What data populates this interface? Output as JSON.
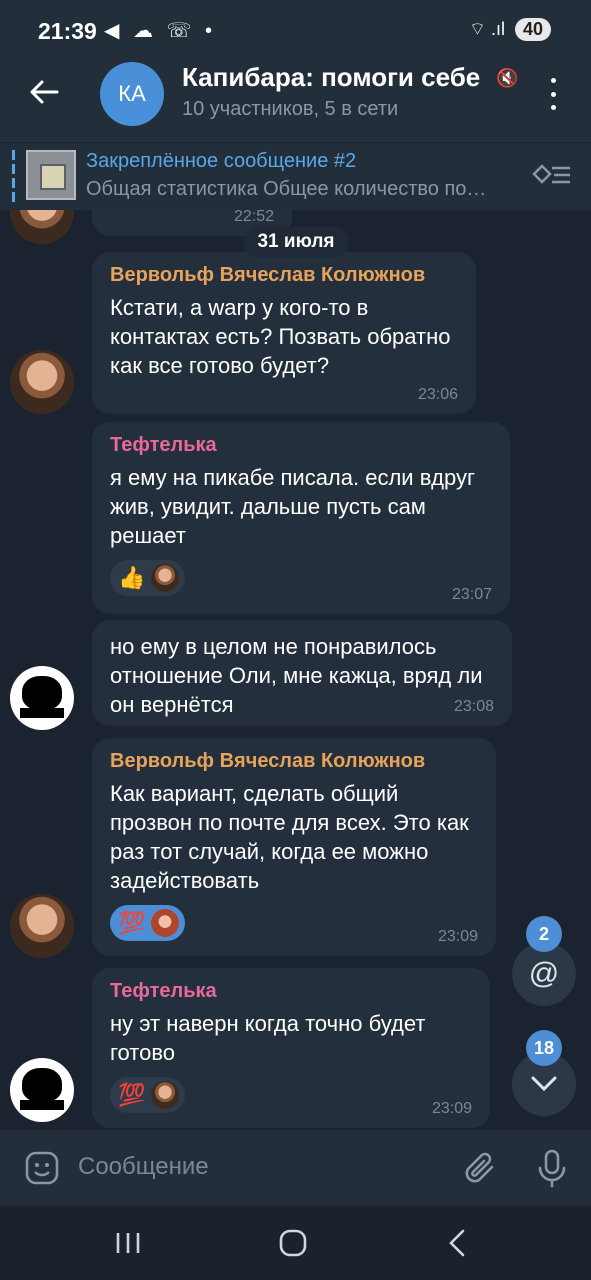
{
  "status": {
    "time": "21:39",
    "icons": "◀ ☁ ☏ •",
    "signal": "⌔ .ıl",
    "battery": "40"
  },
  "header": {
    "avatar_initials": "КА",
    "title": "Капибара: помоги себе",
    "subtitle": "10 участников, 5 в сети"
  },
  "pinned": {
    "title": "Закреплённое сообщение #2",
    "text": "Общая статистика Общее количество по…"
  },
  "partial_top": {
    "time": "22:52"
  },
  "date_chip": "31 июля",
  "messages": [
    {
      "sender": "Вервольф Вячеслав Колюжнов",
      "sender_color": "#e8a35a",
      "text": "Кстати, а warp у кого-то в контактах есть? Позвать обратно как все готово будет?",
      "time": "23:06"
    },
    {
      "sender": "Тефтелька",
      "sender_color": "#e86a9a",
      "text": "я ему на пикабе писала. если вдруг жив, увидит. дальше пусть сам решает",
      "time": "23:07",
      "reaction": "👍"
    },
    {
      "text": "но ему в целом не понравилось отношение Оли, мне кажца, вряд ли он вернётся",
      "time": "23:08"
    },
    {
      "sender": "Вервольф Вячеслав Колюжнов",
      "sender_color": "#e8a35a",
      "text": "Как вариант, сделать общий прозвон по почте для всех. Это как раз тот случай, когда ее можно задействовать",
      "time": "23:09",
      "reaction": "💯"
    },
    {
      "sender": "Тефтелька",
      "sender_color": "#e86a9a",
      "text": "ну эт наверн когда точно будет готово",
      "time": "23:09",
      "reaction": "💯"
    }
  ],
  "fabs": {
    "mentions_count": "2",
    "unread_count": "18"
  },
  "input": {
    "placeholder": "Сообщение"
  },
  "colors": {
    "accent": "#5aa7e8",
    "badge": "#4d8ed6",
    "bubble": "#242f3d",
    "background": "#1b2330"
  }
}
